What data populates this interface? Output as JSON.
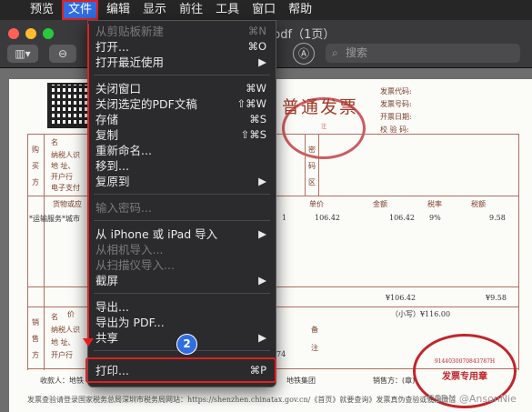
{
  "menubar": {
    "items": [
      "预览",
      "文件",
      "编辑",
      "显示",
      "前往",
      "工具",
      "窗口",
      "帮助"
    ]
  },
  "window": {
    "title": "pdf（1页）"
  },
  "search": {
    "placeholder": "搜索"
  },
  "invoice": {
    "title": "普通发票",
    "meta": [
      "发票代码:",
      "发票号码:",
      "开票日期:",
      "校 验 码:"
    ],
    "buyer_labels": [
      "购",
      "买",
      "方"
    ],
    "buyer_fields": [
      "名",
      "纳税人识",
      "地 址、",
      "开户行",
      "电子支付"
    ],
    "secret_label": [
      "密",
      "码",
      "区"
    ],
    "columns": [
      "货物或应",
      "单价",
      "金额",
      "税率",
      "税额"
    ],
    "item": "*运输服务*城市",
    "qty": "1",
    "unit_price": "106.42",
    "amount": "106.42",
    "rate": "9%",
    "tax": "9.58",
    "amount_total": "¥106.42",
    "tax_total": "¥9.58",
    "total_label": "价",
    "total_small": "（小写）¥116.00",
    "seller_labels": [
      "销",
      "售",
      "方"
    ],
    "seller_fields": [
      "名",
      "纳税人识",
      "地 址、",
      "开户行"
    ],
    "seller_extra": "74",
    "remarks_label": [
      "备",
      "注"
    ],
    "payee": "收款人：地铁",
    "seller_name": "地铁集团",
    "issuer": "销售方：(章)",
    "stamp1_text": "注",
    "stamp2_text": "发票专用章",
    "stamp2_id": "9144030070843787H"
  },
  "file_menu": {
    "items": [
      {
        "label": "从剪贴板新建",
        "shortcut": "⌘N",
        "disabled": true
      },
      {
        "label": "打开...",
        "shortcut": "⌘O",
        "disabled": false
      },
      {
        "label": "打开最近使用",
        "shortcut": "▶",
        "disabled": false
      },
      {
        "label": "关闭窗口",
        "shortcut": "⌘W",
        "disabled": false
      },
      {
        "label": "关闭选定的PDF文稿",
        "shortcut": "⇧⌘W",
        "disabled": false
      },
      {
        "label": "存储",
        "shortcut": "⌘S",
        "disabled": false
      },
      {
        "label": "复制",
        "shortcut": "⇧⌘S",
        "disabled": false
      },
      {
        "label": "重新命名...",
        "shortcut": "",
        "disabled": false
      },
      {
        "label": "移到...",
        "shortcut": "",
        "disabled": false
      },
      {
        "label": "复原到",
        "shortcut": "▶",
        "disabled": false
      },
      {
        "label": "输入密码...",
        "shortcut": "",
        "disabled": true
      },
      {
        "label": "从 iPhone 或 iPad 导入",
        "shortcut": "▶",
        "disabled": false
      },
      {
        "label": "从相机导入...",
        "shortcut": "",
        "disabled": true
      },
      {
        "label": "从扫描仪导入...",
        "shortcut": "",
        "disabled": true
      },
      {
        "label": "截屏",
        "shortcut": "▶",
        "disabled": false
      },
      {
        "label": "导出...",
        "shortcut": "",
        "disabled": false
      },
      {
        "label": "导出为 PDF...",
        "shortcut": "",
        "disabled": false
      },
      {
        "label": "共享",
        "shortcut": "▶",
        "disabled": false
      },
      {
        "label": "打印...",
        "shortcut": "⌘P",
        "disabled": false
      }
    ]
  },
  "annotation": {
    "step": "2"
  },
  "footer": {
    "text": "发票查验请登录国家税务总局深圳市税务局网站：https://shenzhen.chinatax.gov.cn/《首页》就要查询》发票真伪查验或使用微信",
    "watermark": "CSDN @AnsonNie"
  },
  "colors": {
    "accent": "#2f6de0",
    "highlight": "#e02020",
    "stamp": "#c0262b"
  }
}
